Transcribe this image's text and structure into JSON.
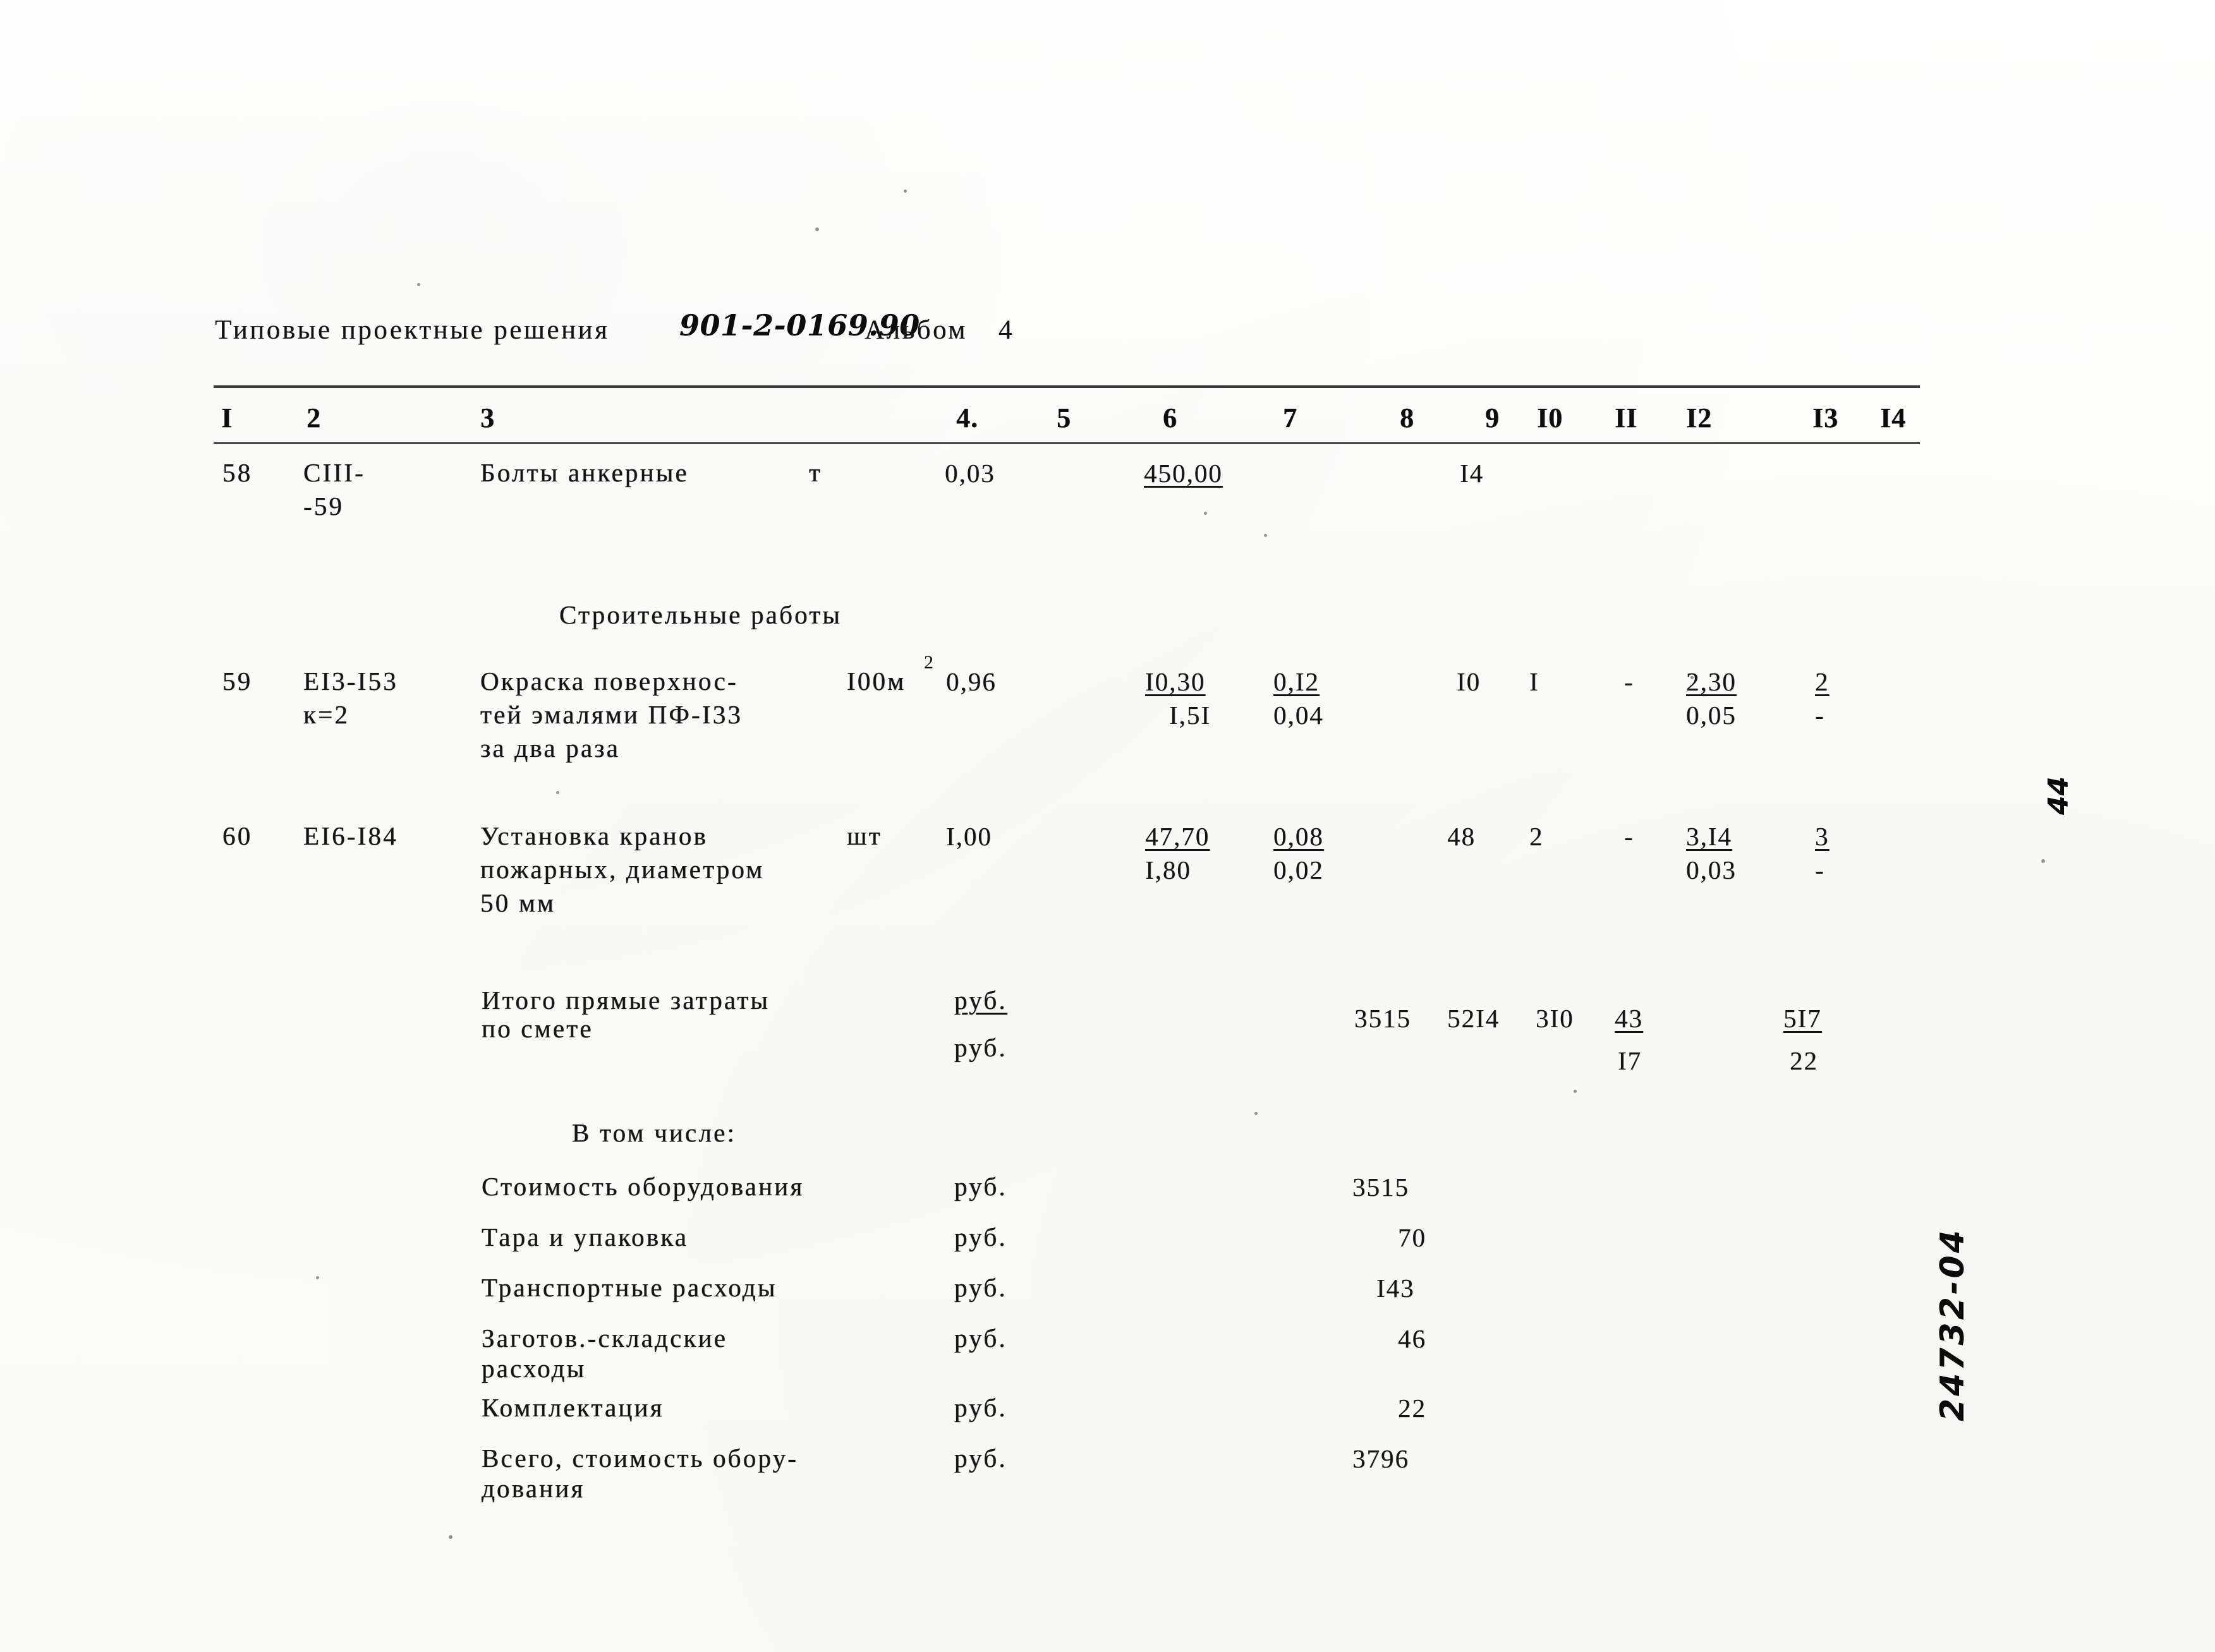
{
  "document": {
    "header": {
      "prefix": "Типовые проектные решения",
      "code": "901-2-0169.90",
      "album_label": "Альбом",
      "album_number": "4"
    },
    "column_headers": [
      "I",
      "2",
      "3",
      "4.",
      "5",
      "6",
      "7",
      "8",
      "9",
      "I0",
      "II",
      "I2",
      "I3",
      "I4"
    ],
    "rows": [
      {
        "no": "58",
        "code_line1": "CIII-",
        "code_line2": "-59",
        "name_line1": "Болты анкерные",
        "unit": "т",
        "qty": "0,03",
        "c6_line1": "450,00",
        "c8": "I4"
      },
      {
        "no": "59",
        "code_line1": "EI3-I53",
        "code_line2": "к=2",
        "name_line1": "Окраска поверхнос-",
        "name_line2": "тей эмалями ПФ-I33",
        "name_line3": "за два раза",
        "unit": "I00м",
        "unit_sup": "2",
        "qty": "0,96",
        "c6_line1": "I0,30",
        "c6_line2": "I,5I",
        "c7_line1": "0,I2",
        "c7_line2": "0,04",
        "c8": "I0",
        "c9": "I",
        "c11": "-",
        "c12_line1": "2,30",
        "c12_line2": "0,05",
        "c13_line1": "2",
        "c13_line2": "-"
      },
      {
        "no": "60",
        "code_line1": "EI6-I84",
        "name_line1": "Установка кранов",
        "name_line2": "пожарных, диаметром",
        "name_line3": "50 мм",
        "unit": "шт",
        "qty": "I,00",
        "c6_line1": "47,70",
        "c6_line2": "I,80",
        "c7_line1": "0,08",
        "c7_line2": "0,02",
        "c8": "48",
        "c9": "2",
        "c11": "-",
        "c12_line1": "3,I4",
        "c12_line2": "0,03",
        "c13_line1": "3",
        "c13_line2": "-"
      }
    ],
    "section_heading": "Строительные работы",
    "totals": {
      "label_line1": "Итого прямые затраты",
      "label_line2": "по смете",
      "unit_line1": "руб.",
      "unit_line2": "руб.",
      "c8": "3515",
      "c9": "52I4",
      "c10": "3I0",
      "c11_line1": "43",
      "c11_line2": "I7",
      "c13_line1": "5I7",
      "c13_line2": "22"
    },
    "breakdown": {
      "heading": "В том числе:",
      "items": [
        {
          "label_line1": "Стоимость оборудования",
          "unit": "руб.",
          "value": "3515"
        },
        {
          "label_line1": "Тара и упаковка",
          "unit": "руб.",
          "value": "70"
        },
        {
          "label_line1": "Транспортные расходы",
          "unit": "руб.",
          "value": "I43"
        },
        {
          "label_line1": "Заготов.-складские",
          "label_line2": "расходы",
          "unit": "руб.",
          "value": "46"
        },
        {
          "label_line1": "Комплектация",
          "unit": "руб.",
          "value": "22"
        },
        {
          "label_line1": "Всего, стоимость обору-",
          "label_line2": "дования",
          "unit": "руб.",
          "value": "3796"
        }
      ]
    },
    "margin": {
      "code": "24732-04",
      "mark": "44"
    }
  }
}
